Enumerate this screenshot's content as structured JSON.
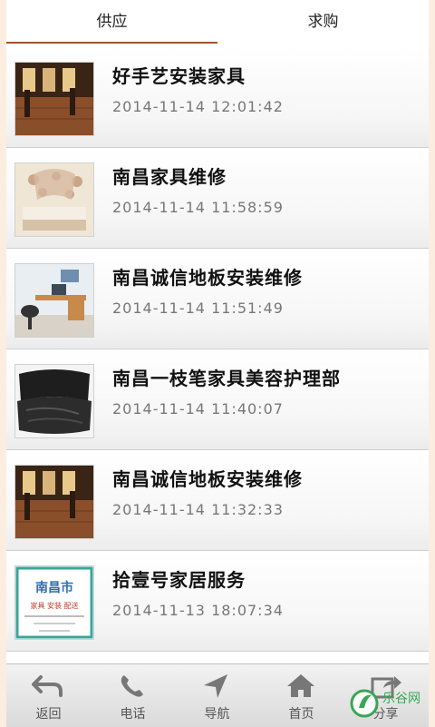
{
  "tabs": [
    {
      "label": "供应",
      "active": true
    },
    {
      "label": "求购",
      "active": false
    }
  ],
  "items": [
    {
      "title": "好手艺安装家具",
      "date": "2014-11-14  12:01:42",
      "thumb": "wood-floor-room"
    },
    {
      "title": "南昌家具维修",
      "date": "2014-11-14  11:58:59",
      "thumb": "bedroom"
    },
    {
      "title": "南昌诚信地板安装维修",
      "date": "2014-11-14  11:51:49",
      "thumb": "office-desk"
    },
    {
      "title": "南昌一枝笔家具美容护理部",
      "date": "2014-11-14  11:40:07",
      "thumb": "leather-chair"
    },
    {
      "title": "南昌诚信地板安装维修",
      "date": "2014-11-14  11:32:33",
      "thumb": "wood-floor-room"
    },
    {
      "title": "拾壹号家居服务",
      "date": "2014-11-13  18:07:34",
      "thumb": "flyer"
    }
  ],
  "flyer": {
    "city": "南昌市",
    "services": "家具 安装 配送"
  },
  "nav": [
    {
      "label": "返回",
      "icon": "back-arrow-icon"
    },
    {
      "label": "电话",
      "icon": "phone-icon"
    },
    {
      "label": "导航",
      "icon": "navigation-arrow-icon"
    },
    {
      "label": "首页",
      "icon": "home-icon"
    },
    {
      "label": "分享",
      "icon": "share-icon"
    }
  ],
  "watermark": {
    "text": "乐谷网"
  },
  "colors": {
    "accent": "#a0522d",
    "background": "#fbeee0"
  }
}
